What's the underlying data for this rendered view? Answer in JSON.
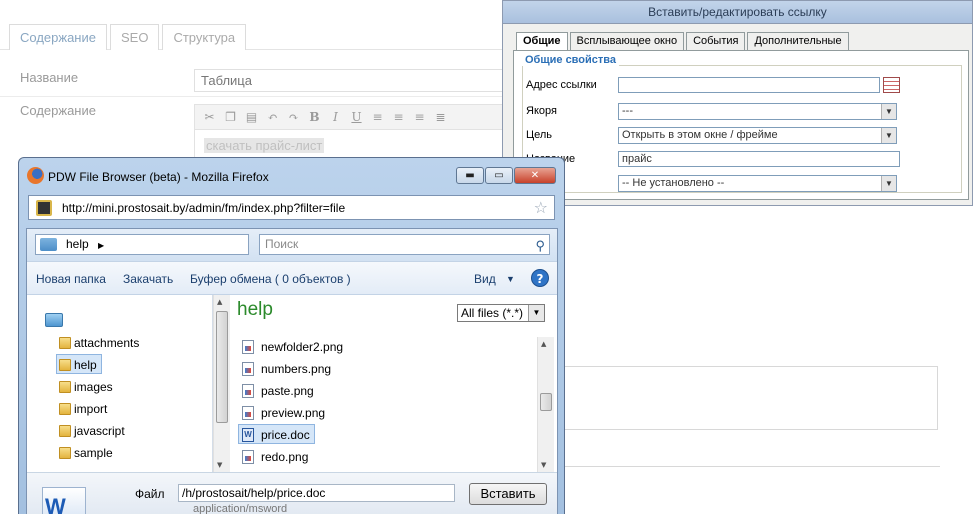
{
  "cms": {
    "tabs": [
      {
        "label": "Содержание"
      },
      {
        "label": "SEO"
      },
      {
        "label": "Структура"
      }
    ],
    "name_label": "Название",
    "name_value": "Таблица",
    "content_label": "Содержание",
    "selected_text": "скачать прайс-лист"
  },
  "link_dialog": {
    "title": "Вставить/редактировать ссылку",
    "tabs": [
      {
        "label": "Общие"
      },
      {
        "label": "Всплывающее окно"
      },
      {
        "label": "События"
      },
      {
        "label": "Дополнительные"
      }
    ],
    "legend": "Общие свойства",
    "url_label": "Адрес ссылки",
    "url_value": "",
    "anchor_label": "Якоря",
    "anchor_value": "---",
    "target_label": "Цель",
    "target_value": "Открыть в этом окне / фрейме",
    "title_label": "Название",
    "title_value": "прайс",
    "class_value": "-- Не установлено --"
  },
  "firefox": {
    "window_title": "PDW File Browser (beta) - Mozilla Firefox",
    "url": "http://mini.prostosait.by/admin/fm/index.php?filter=file",
    "controls": {
      "minimize": "▬",
      "maximize": "▭",
      "close": "✕"
    }
  },
  "file_browser": {
    "path": "help",
    "search_placeholder": "Поиск",
    "toolbar": {
      "new_folder": "Новая папка",
      "upload": "Закачать",
      "clipboard": "Буфер обмена ( 0 объектов )",
      "view": "Вид"
    },
    "tree": [
      {
        "label": "attachments"
      },
      {
        "label": "help"
      },
      {
        "label": "images"
      },
      {
        "label": "import"
      },
      {
        "label": "javascript"
      },
      {
        "label": "sample"
      }
    ],
    "folder_title": "help",
    "filter": "All files (*.*)",
    "files": [
      {
        "name": "newfolder2.png"
      },
      {
        "name": "numbers.png"
      },
      {
        "name": "paste.png"
      },
      {
        "name": "preview.png"
      },
      {
        "name": "price.doc"
      },
      {
        "name": "redo.png"
      }
    ],
    "file_label": "Файл",
    "file_path": "/h/prostosait/help/price.doc",
    "mime": "application/msword",
    "insert_button": "Вставить"
  },
  "colors": {
    "accent": "#2b8a2b",
    "selection": "#d5e6f8",
    "dialog_title": "#a9c0de",
    "legend": "#2b6fb6"
  }
}
